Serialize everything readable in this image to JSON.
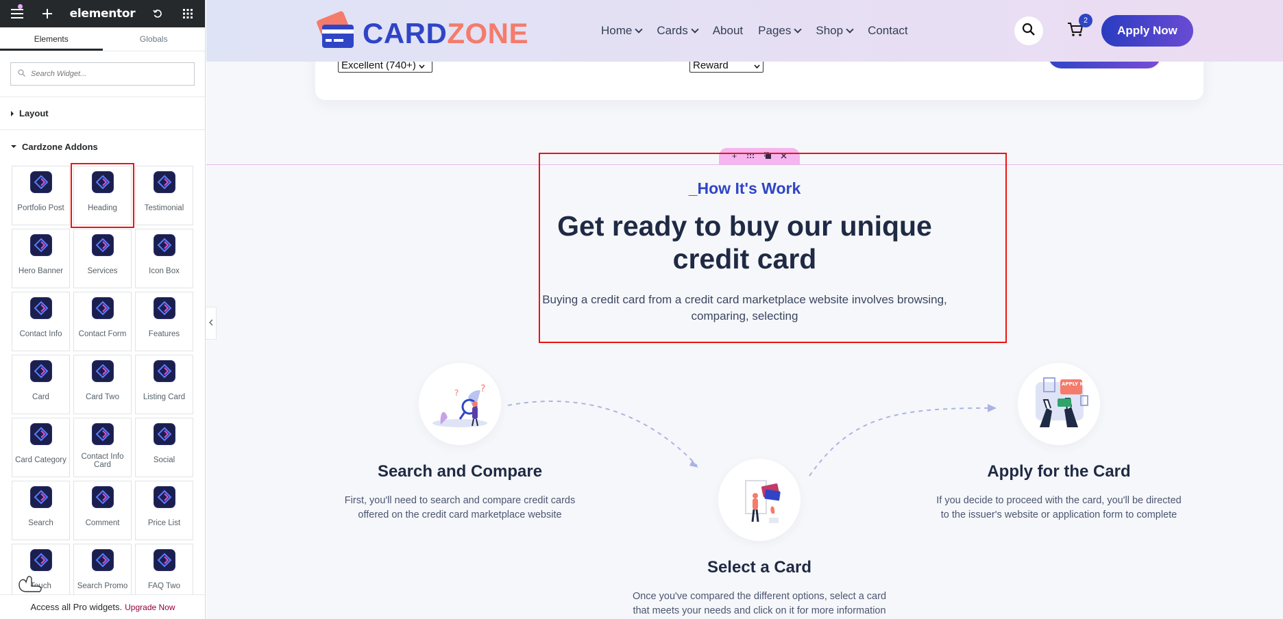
{
  "panel": {
    "logo": "elementor",
    "tabs": [
      "Elements",
      "Globals"
    ],
    "search_placeholder": "Search Widget...",
    "categories": {
      "layout": "Layout",
      "addons": "Cardzone Addons"
    },
    "widgets": [
      "Portfolio Post",
      "Heading",
      "Testimonial",
      "Hero Banner",
      "Services",
      "Icon Box",
      "Contact Info",
      "Contact Form",
      "Features",
      "Card",
      "Card Two",
      "Listing Card",
      "Card Category",
      "Contact Info Card",
      "Social",
      "Search",
      "Comment",
      "Price List",
      "Touch",
      "Search Promo",
      "FAQ Two"
    ],
    "footer_text": "Access all Pro widgets.",
    "footer_link": "Upgrade Now"
  },
  "site": {
    "brand_a": "CARD",
    "brand_b": "ZONE",
    "nav": [
      {
        "label": "Home",
        "dropdown": true
      },
      {
        "label": "Cards",
        "dropdown": true
      },
      {
        "label": "About",
        "dropdown": false
      },
      {
        "label": "Pages",
        "dropdown": true
      },
      {
        "label": "Shop",
        "dropdown": true
      },
      {
        "label": "Contact",
        "dropdown": false
      }
    ],
    "cart_count": "2",
    "apply_button": "Apply Now",
    "form": {
      "credit_select": "Excellent (740+)",
      "type_select": "Reward"
    },
    "section": {
      "kicker": "_How It's Work",
      "headline_line1": "Get ready to buy our unique",
      "headline_line2": "credit card",
      "subtext_line1": "Buying a credit card from a credit card marketplace website involves browsing,",
      "subtext_line2": "comparing, selecting"
    },
    "steps": [
      {
        "title": "Search and Compare",
        "desc1": "First, you'll need to search and compare credit cards",
        "desc2": "offered on the credit card marketplace website"
      },
      {
        "title": "Select a Card",
        "desc1": "Once you've compared the different options, select a card",
        "desc2": "that meets your needs and click on it for more information"
      },
      {
        "title": "Apply for the Card",
        "desc1": "If you decide to proceed with the card, you'll be directed",
        "desc2": "to the issuer's website or application form to complete"
      }
    ],
    "apply_illustration_text": "APPLY NOW"
  },
  "colors": {
    "brand_blue": "#2f45c6",
    "brand_coral": "#f57b6b",
    "panel_dark": "#26292c",
    "selection_red": "#ee1111"
  }
}
